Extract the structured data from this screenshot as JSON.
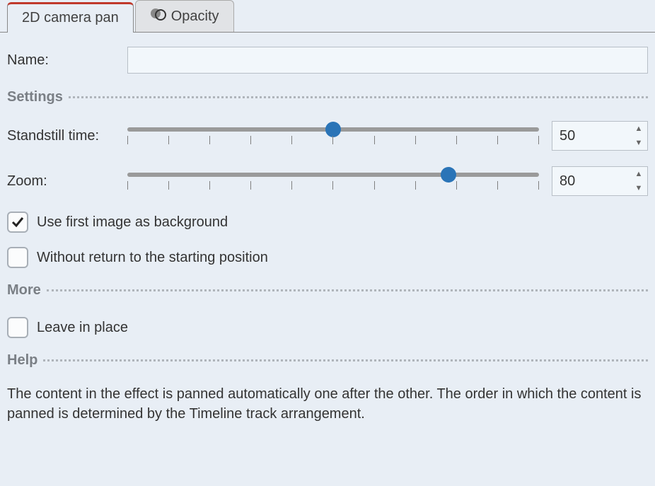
{
  "tabs": {
    "active": "2D camera pan",
    "inactive": "Opacity"
  },
  "fields": {
    "name_label": "Name:",
    "name_value": ""
  },
  "sections": {
    "settings": "Settings",
    "more": "More",
    "help": "Help"
  },
  "sliders": {
    "standstill": {
      "label": "Standstill time:",
      "value": "50",
      "min": 0,
      "max": 100,
      "percent": 50
    },
    "zoom": {
      "label": "Zoom:",
      "value": "80",
      "min": 0,
      "max": 100,
      "percent": 78
    }
  },
  "checks": {
    "use_first_bg": {
      "label": "Use first image as background",
      "checked": true
    },
    "without_return": {
      "label": "Without return to the starting position",
      "checked": false
    },
    "leave_in_place": {
      "label": "Leave in place",
      "checked": false
    }
  },
  "help_text": "The content in the effect is panned automatically one after the other. The order in which the content is panned is determined by the Timeline track arrangement."
}
